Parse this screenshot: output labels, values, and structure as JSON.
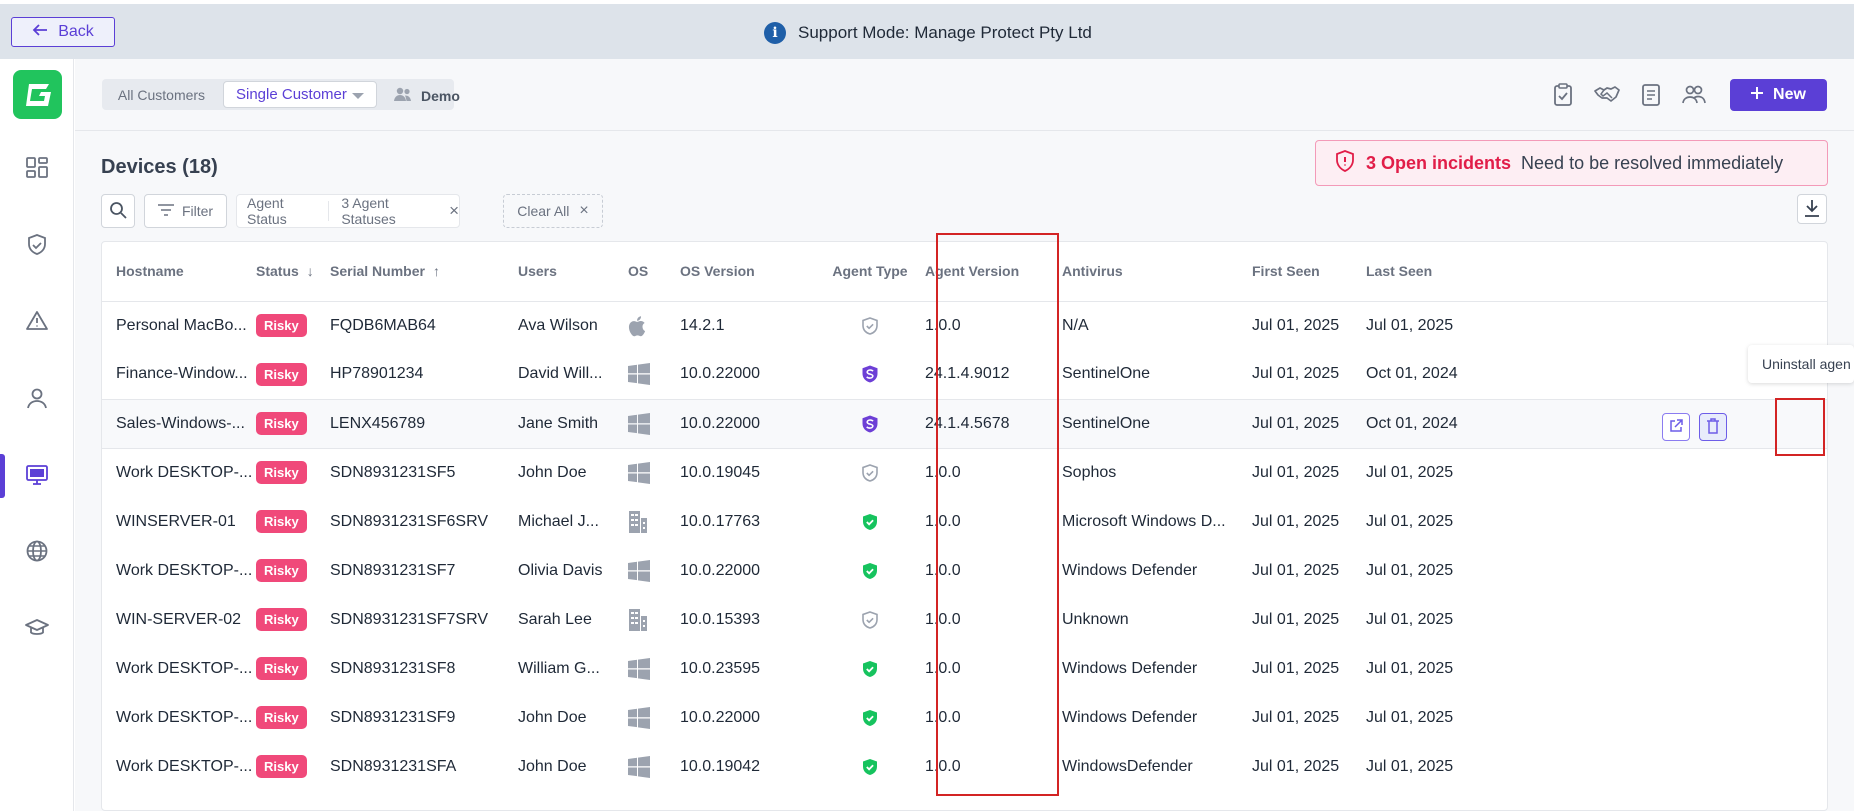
{
  "banner": {
    "back_label": "Back",
    "support_text": "Support Mode: Manage Protect Pty Ltd"
  },
  "topbar": {
    "all_customers": "All Customers",
    "single_customer": "Single Customer",
    "customer_name": "Demo",
    "new_label": "New"
  },
  "page": {
    "title": "Devices (18)",
    "incident_count": "3 Open incidents",
    "incident_message": "Need to be resolved immediately"
  },
  "filters": {
    "filter_label": "Filter",
    "chip_name": "Agent Status",
    "chip_value": "3 Agent Statuses",
    "clear_all": "Clear All"
  },
  "table": {
    "columns": [
      "Hostname",
      "Status",
      "Serial Number",
      "Users",
      "OS",
      "OS Version",
      "Agent Type",
      "Agent Version",
      "Antivirus",
      "First Seen",
      "Last Seen"
    ],
    "rows": [
      {
        "hostname": "Personal MacBo...",
        "status": "Risky",
        "serial": "FQDB6MAB64",
        "user": "Ava Wilson",
        "os": "apple",
        "os_version": "14.2.1",
        "agent_type": "shield-outline",
        "agent_version": "1.0.0",
        "antivirus": "N/A",
        "first_seen": "Jul 01, 2025",
        "last_seen": "Jul 01, 2025"
      },
      {
        "hostname": "Finance-Window...",
        "status": "Risky",
        "serial": "HP78901234",
        "user": "David Will...",
        "os": "windows",
        "os_version": "10.0.22000",
        "agent_type": "sentinelone",
        "agent_version": "24.1.4.9012",
        "antivirus": "SentinelOne",
        "first_seen": "Jul 01, 2025",
        "last_seen": "Oct 01, 2024"
      },
      {
        "hostname": "Sales-Windows-...",
        "status": "Risky",
        "serial": "LENX456789",
        "user": "Jane Smith",
        "os": "windows",
        "os_version": "10.0.22000",
        "agent_type": "sentinelone",
        "agent_version": "24.1.4.5678",
        "antivirus": "SentinelOne",
        "first_seen": "Jul 01, 2025",
        "last_seen": "Oct 01, 2024"
      },
      {
        "hostname": "Work DESKTOP-...",
        "status": "Risky",
        "serial": "SDN8931231SF5",
        "user": "John Doe",
        "os": "windows",
        "os_version": "10.0.19045",
        "agent_type": "shield-outline",
        "agent_version": "1.0.0",
        "antivirus": "Sophos",
        "first_seen": "Jul 01, 2025",
        "last_seen": "Jul 01, 2025"
      },
      {
        "hostname": "WINSERVER-01",
        "status": "Risky",
        "serial": "SDN8931231SF6SRV",
        "user": "Michael J...",
        "os": "server",
        "os_version": "10.0.17763",
        "agent_type": "shield-green",
        "agent_version": "1.0.0",
        "antivirus": "Microsoft Windows D...",
        "first_seen": "Jul 01, 2025",
        "last_seen": "Jul 01, 2025"
      },
      {
        "hostname": "Work DESKTOP-...",
        "status": "Risky",
        "serial": "SDN8931231SF7",
        "user": "Olivia Davis",
        "os": "windows",
        "os_version": "10.0.22000",
        "agent_type": "shield-green",
        "agent_version": "1.0.0",
        "antivirus": "Windows Defender",
        "first_seen": "Jul 01, 2025",
        "last_seen": "Jul 01, 2025"
      },
      {
        "hostname": "WIN-SERVER-02",
        "status": "Risky",
        "serial": "SDN8931231SF7SRV",
        "user": "Sarah Lee",
        "os": "server",
        "os_version": "10.0.15393",
        "agent_type": "shield-outline",
        "agent_version": "1.0.0",
        "antivirus": "Unknown",
        "first_seen": "Jul 01, 2025",
        "last_seen": "Jul 01, 2025"
      },
      {
        "hostname": "Work DESKTOP-...",
        "status": "Risky",
        "serial": "SDN8931231SF8",
        "user": "William G...",
        "os": "windows",
        "os_version": "10.0.23595",
        "agent_type": "shield-green",
        "agent_version": "1.0.0",
        "antivirus": "Windows Defender",
        "first_seen": "Jul 01, 2025",
        "last_seen": "Jul 01, 2025"
      },
      {
        "hostname": "Work DESKTOP-...",
        "status": "Risky",
        "serial": "SDN8931231SF9",
        "user": "John Doe",
        "os": "windows",
        "os_version": "10.0.22000",
        "agent_type": "shield-green",
        "agent_version": "1.0.0",
        "antivirus": "Windows Defender",
        "first_seen": "Jul 01, 2025",
        "last_seen": "Jul 01, 2025"
      },
      {
        "hostname": "Work DESKTOP-...",
        "status": "Risky",
        "serial": "SDN8931231SFA",
        "user": "John Doe",
        "os": "windows",
        "os_version": "10.0.19042",
        "agent_type": "shield-green",
        "agent_version": "1.0.0",
        "antivirus": "WindowsDefender",
        "first_seen": "Jul 01, 2025",
        "last_seen": "Jul 01, 2025"
      }
    ]
  },
  "tooltip": {
    "text": "Uninstall agen"
  },
  "colors": {
    "accent": "#5b3fd6",
    "risky": "#f0497a",
    "brand_green": "#21c45d",
    "highlight": "#d32424"
  }
}
